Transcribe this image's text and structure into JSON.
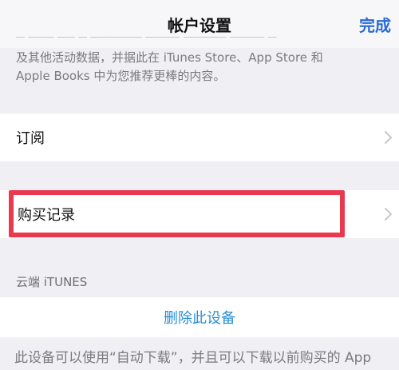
{
  "navbar": {
    "title": "帐户设置",
    "done_label": "完成"
  },
  "info": {
    "text_lines": [
      "及其他活动数据，并据此在 iTunes Store、App Store 和",
      "Apple Books 中为您推荐更棒的内容。"
    ]
  },
  "rows": {
    "subscriptions_label": "订阅",
    "purchase_history_label": "购买记录"
  },
  "cloud_section": {
    "header": "云端 iTUNES",
    "delete_device_label": "删除此设备",
    "footer_text": "此设备可以使用“自动下载”，并且可以下载以前购买的 App"
  },
  "colors": {
    "accent": "#2a6ad6",
    "delete_link": "#2a8fd6",
    "highlight_border": "#e8394f",
    "background": "#efeff4"
  },
  "icons": {
    "chevron": "chevron-right-icon"
  }
}
